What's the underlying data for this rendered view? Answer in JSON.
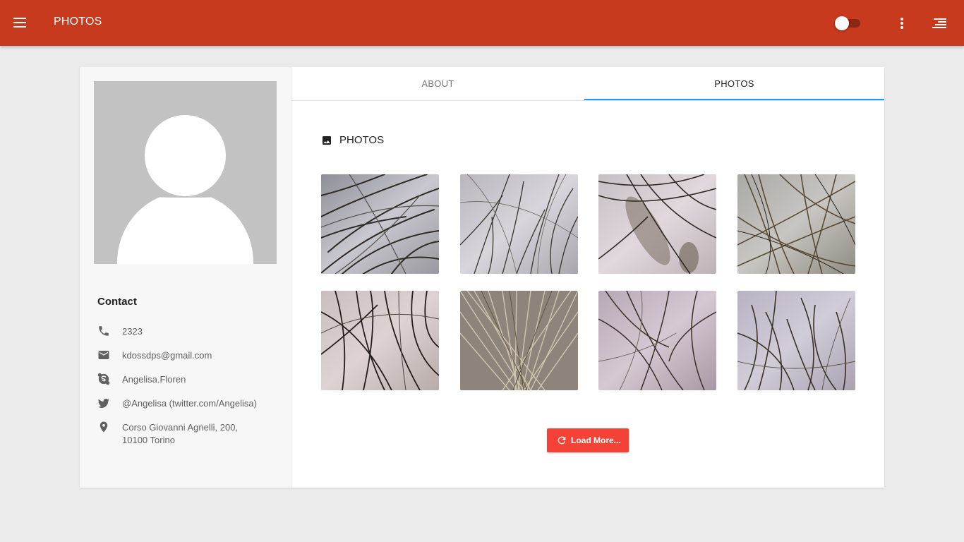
{
  "appbar": {
    "title": "PHOTOS",
    "accent_color": "#c73a1e",
    "menu_icon": "menu-icon",
    "toggle_state": "off",
    "overflow_icon": "more-vert-icon",
    "sort_icon": "sort-icon"
  },
  "profile": {
    "avatar_icon": "person-placeholder-icon",
    "contact_title": "Contact",
    "contacts": [
      {
        "icon": "phone-icon",
        "text": "2323"
      },
      {
        "icon": "email-icon",
        "text": "kdossdps@gmail.com"
      },
      {
        "icon": "skype-icon",
        "text": "Angelisa.Floren"
      },
      {
        "icon": "twitter-icon",
        "text": "@Angelisa (twitter.com/Angelisa)"
      },
      {
        "icon": "location-icon",
        "text_line1": "Corso Giovanni Agnelli, 200,",
        "text_line2": "10100 Torino"
      }
    ]
  },
  "tabs": [
    {
      "label": "ABOUT",
      "active": false
    },
    {
      "label": "PHOTOS",
      "active": true
    }
  ],
  "tab_indicator_color": "#2196f3",
  "photos_section": {
    "icon": "image-icon",
    "title": "PHOTOS",
    "photo_count": 8,
    "load_more_label": "Load More...",
    "load_more_icon": "refresh-icon",
    "load_more_color": "#f44336"
  }
}
